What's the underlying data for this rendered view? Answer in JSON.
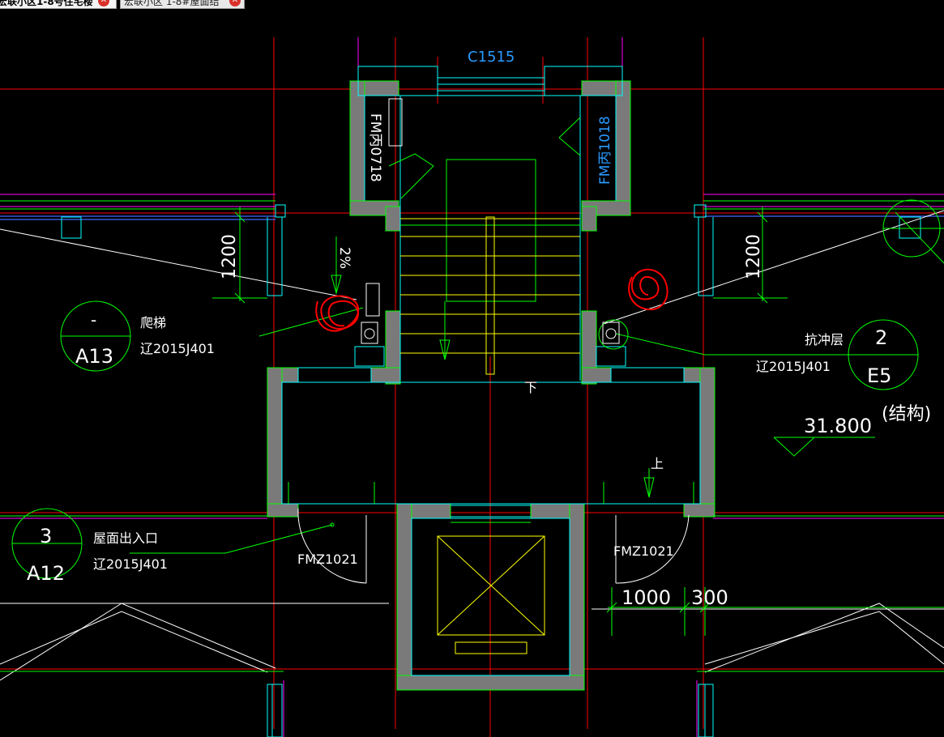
{
  "tabs": [
    {
      "label": "宏联小区1-8号住宅楼",
      "active": true,
      "close": "✕"
    },
    {
      "label": "宏联小区 1-8#屋面结",
      "active": false,
      "close": "✕"
    }
  ],
  "drawing": {
    "window_tag": "C1515",
    "door_left_vertical": "FM丙0718",
    "door_right_vertical": "FM丙1018",
    "dim_left": "1200",
    "dim_right": "1200",
    "slope": "2%",
    "stair_down": "下",
    "stair_up": "上",
    "callout_a13": {
      "top": "-",
      "bottom": "A13",
      "title": "爬梯",
      "ref": "辽2015J401"
    },
    "callout_e5": {
      "top": "2",
      "bottom": "E5",
      "title": "抗冲层",
      "ref": "辽2015J401"
    },
    "callout_a12": {
      "top": "3",
      "bottom": "A12",
      "title": "屋面出入口",
      "ref": "辽2015J401"
    },
    "elevation": "31.800",
    "elevation_note": "(结构)",
    "door_left_bottom": "FMZ1021",
    "door_right_bottom": "FMZ1021",
    "dim_bottom_1": "1000",
    "dim_bottom_2": "300"
  },
  "colors": {
    "wall_fill": "#7a7a7a",
    "green": "#00ff00",
    "cyan": "#00ffff",
    "yellow": "#ffff00",
    "red": "#ff0000",
    "magenta": "#ff00ff",
    "blue": "#3c6cff",
    "white": "#ffffff",
    "tag_blue": "#2a9bff"
  }
}
